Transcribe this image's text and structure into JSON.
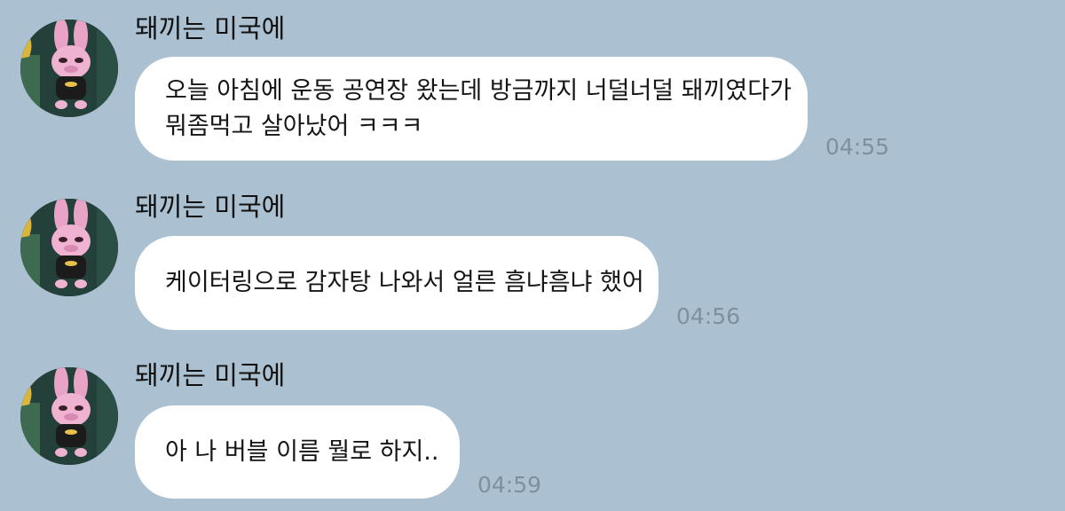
{
  "chat": {
    "messages": [
      {
        "sender": "돼끼는 미국에",
        "lines": [
          "오늘 아침에 운동 공연장 왔는데 방금까지 너덜너덜 돼끼였다가",
          "뭐좀먹고 살아났어 ㅋㅋㅋ"
        ],
        "time": "04:55"
      },
      {
        "sender": "돼끼는 미국에",
        "lines": [
          "케이터링으로 감자탕 나와서 얼른 흠냐흠냐 했어"
        ],
        "time": "04:56"
      },
      {
        "sender": "돼끼는 미국에",
        "lines": [
          "아 나 버블 이름 뭘로 하지.."
        ],
        "time": "04:59"
      }
    ]
  },
  "avatar_icon": "plush-bunny-avatar-icon",
  "colors": {
    "background": "#abc1d1",
    "bubble": "#ffffff",
    "timestamp": "#7f909d"
  }
}
